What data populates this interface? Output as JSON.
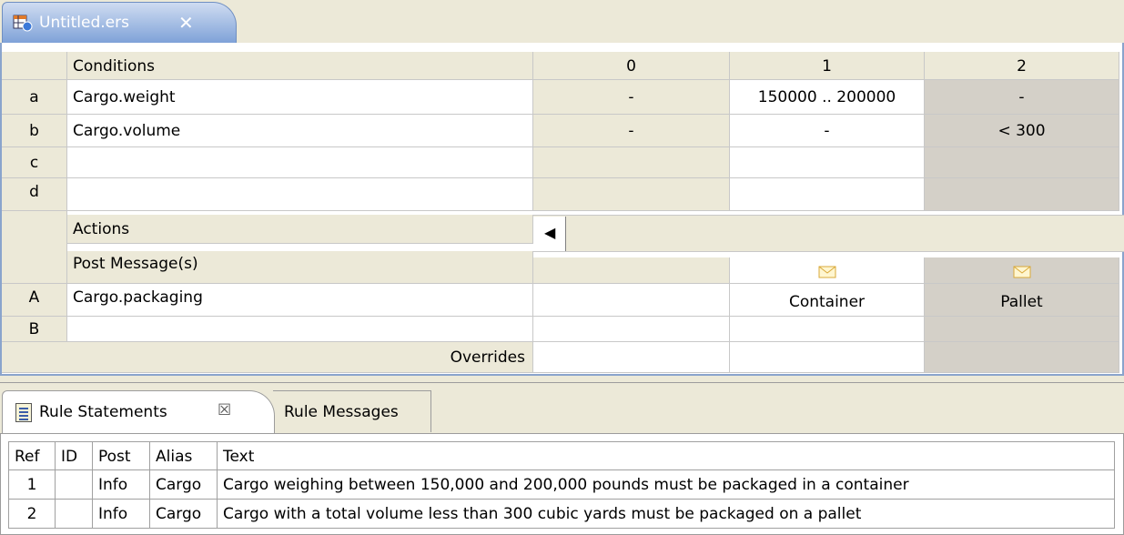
{
  "editor_tab": {
    "title": "Untitled.ers",
    "close": "✕"
  },
  "table": {
    "conditions_header": "Conditions",
    "columns": [
      "0",
      "1",
      "2"
    ],
    "conditions": [
      {
        "letter": "a",
        "name": "Cargo.weight",
        "values": [
          "-",
          "150000 .. 200000",
          "-"
        ]
      },
      {
        "letter": "b",
        "name": "Cargo.volume",
        "values": [
          "-",
          "-",
          "< 300"
        ]
      },
      {
        "letter": "c",
        "name": "",
        "values": [
          "",
          "",
          ""
        ]
      },
      {
        "letter": "d",
        "name": "",
        "values": [
          "",
          "",
          ""
        ]
      }
    ],
    "actions_header": "Actions",
    "post_messages_label": "Post Message(s)",
    "actions": [
      {
        "letter": "A",
        "name": "Cargo.packaging",
        "values": [
          "",
          "Container",
          "Pallet"
        ]
      },
      {
        "letter": "B",
        "name": "",
        "values": [
          "",
          "",
          ""
        ]
      }
    ],
    "overrides_label": "Overrides",
    "scroll_left": "◀"
  },
  "views": {
    "tabs": [
      {
        "label": "Rule Statements",
        "close": "☒",
        "active": true
      },
      {
        "label": "Rule Messages",
        "active": false
      }
    ],
    "statements": {
      "headers": [
        "Ref",
        "ID",
        "Post",
        "Alias",
        "Text"
      ],
      "rows": [
        {
          "ref": "1",
          "id": "",
          "post": "Info",
          "alias": "Cargo",
          "text": "Cargo weighing between 150,000 and 200,000 pounds must be packaged in a container"
        },
        {
          "ref": "2",
          "id": "",
          "post": "Info",
          "alias": "Cargo",
          "text": "Cargo with a total volume less than 300 cubic yards must be packaged on a pallet"
        }
      ]
    }
  },
  "colors": {
    "selected_column": "#d4d0c8",
    "tab_active": "#7fa2d8",
    "message_icon": "#e8c04a"
  },
  "icons": {
    "editor_tab": "decision-table-icon",
    "message": "envelope-icon",
    "view_tab": "document-icon"
  }
}
